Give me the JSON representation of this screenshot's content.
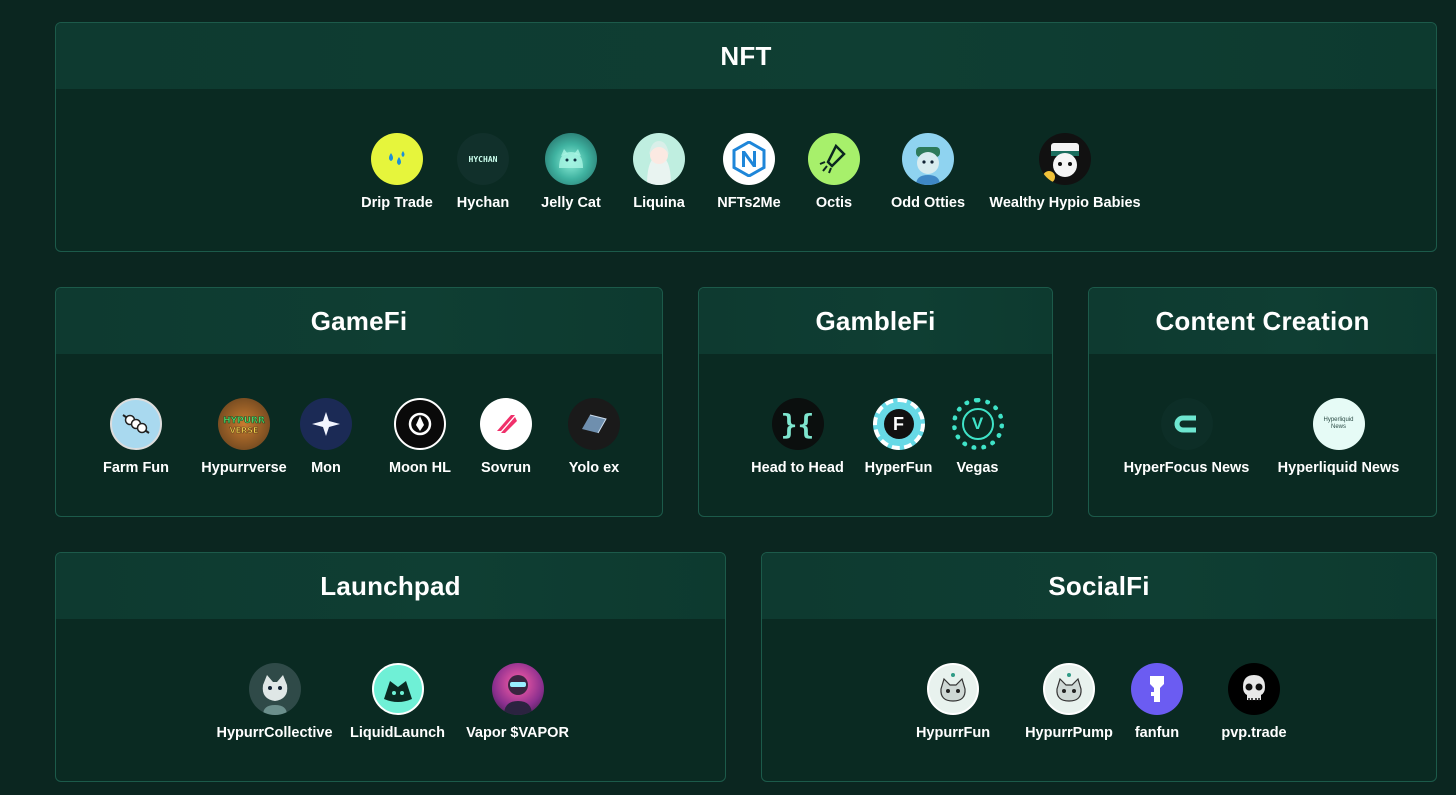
{
  "sections": {
    "nft": {
      "title": "NFT",
      "items": [
        "Drip Trade",
        "Hychan",
        "Jelly Cat",
        "Liquina",
        "NFTs2Me",
        "Octis",
        "Odd Otties",
        "Wealthy Hypio Babies"
      ]
    },
    "gamefi": {
      "title": "GameFi",
      "items": [
        "Farm Fun",
        "Hypurrverse",
        "Mon",
        "Moon HL",
        "Sovrun",
        "Yolo ex"
      ]
    },
    "gamblefi": {
      "title": "GambleFi",
      "items": [
        "Head to Head",
        "HyperFun",
        "Vegas"
      ]
    },
    "content": {
      "title": "Content Creation",
      "items": [
        "HyperFocus News",
        "Hyperliquid News"
      ]
    },
    "launchpad": {
      "title": "Launchpad",
      "items": [
        "HypurrCollective",
        "LiquidLaunch",
        "Vapor $VAPOR"
      ]
    },
    "socialfi": {
      "title": "SocialFi",
      "items": [
        "HypurrFun",
        "HypurrPump",
        "fanfun",
        "pvp.trade"
      ]
    }
  },
  "logo_text": {
    "hychan": "HYCHAN",
    "hyperfun": "F",
    "vegas": "V",
    "hyperliquid_news": "Hyperliquid News"
  },
  "colors": {
    "background": "#0b2620",
    "card_border": "#1c5a4a",
    "card_header": "#0e3a30"
  }
}
